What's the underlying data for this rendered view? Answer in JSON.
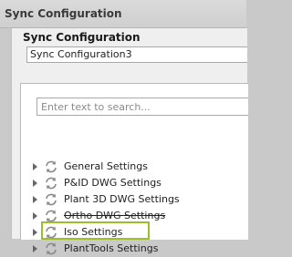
{
  "window": {
    "title": "Sync Configuration"
  },
  "section": {
    "label": "Sync Configuration"
  },
  "config_name": {
    "value": "Sync Configuration3"
  },
  "search": {
    "placeholder": "Enter text to search..."
  },
  "tree": {
    "items": [
      {
        "label": "General Settings",
        "icon": "sync-icon"
      },
      {
        "label": "P&ID DWG Settings",
        "icon": "sync-icon"
      },
      {
        "label": "Plant 3D DWG Settings",
        "icon": "sync-icon"
      },
      {
        "label": "Ortho DWG Settings",
        "icon": "sync-icon"
      },
      {
        "label": "Iso Settings",
        "icon": "sync-icon"
      },
      {
        "label": "PlantTools Settings",
        "icon": "sync-icon"
      }
    ]
  },
  "colors": {
    "highlight": "#9bbf2a"
  }
}
